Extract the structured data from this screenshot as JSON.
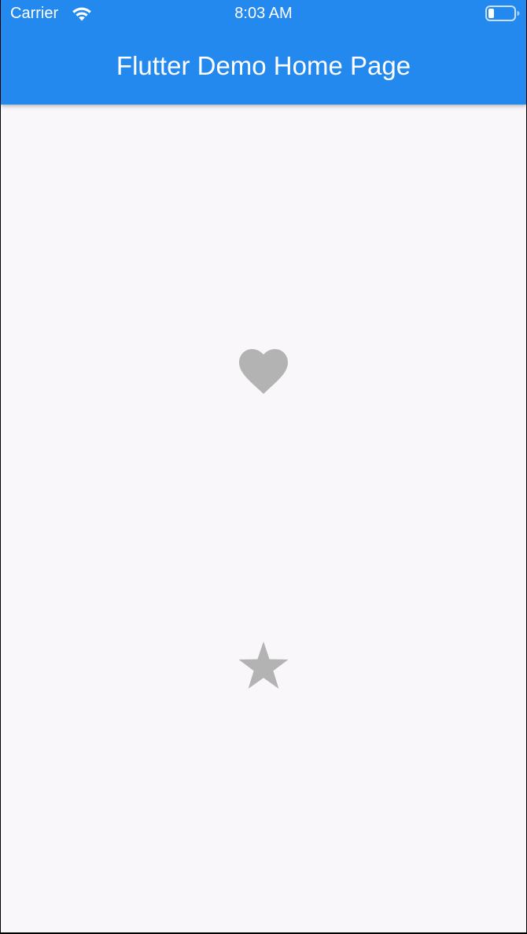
{
  "status_bar": {
    "carrier": "Carrier",
    "time": "8:03 AM",
    "wifi_icon": "wifi-icon",
    "battery_icon": "battery-icon"
  },
  "app_bar": {
    "title": "Flutter Demo Home Page",
    "color": "#2389ef"
  },
  "body": {
    "background": "#faf7fa",
    "icons": [
      {
        "name": "heart-icon",
        "color": "#b3b3b3"
      },
      {
        "name": "star-icon",
        "color": "#b3b3b3"
      }
    ]
  }
}
